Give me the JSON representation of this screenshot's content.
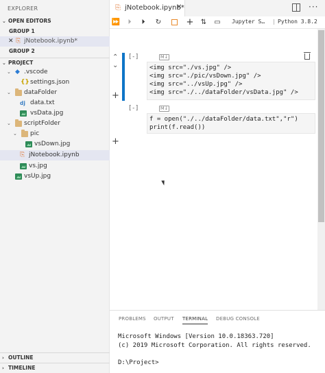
{
  "sidebar": {
    "title": "EXPLORER",
    "open_editors_label": "OPEN EDITORS",
    "group1_label": "GROUP 1",
    "group1_file": "jNotebook.ipynb*",
    "group2_label": "GROUP 2",
    "project_label": "PROJECT",
    "tree": [
      {
        "label": ".vscode",
        "kind": "folder-vscode"
      },
      {
        "label": "settings.json",
        "kind": "json"
      },
      {
        "label": "dataFolder",
        "kind": "folder"
      },
      {
        "label": "data.txt",
        "kind": "dj"
      },
      {
        "label": "vsData.jpg",
        "kind": "image"
      },
      {
        "label": "scriptFolder",
        "kind": "folder"
      },
      {
        "label": "pic",
        "kind": "folder"
      },
      {
        "label": "vsDown.jpg",
        "kind": "image"
      },
      {
        "label": "jNotebook.ipynb",
        "kind": "notebook"
      },
      {
        "label": "vs.jpg",
        "kind": "image"
      },
      {
        "label": "vsUp.jpg",
        "kind": "image"
      }
    ],
    "outline_label": "OUTLINE",
    "timeline_label": "TIMELINE"
  },
  "editor": {
    "tab_label": "jNotebook.ipynb*",
    "kernel_info": "Jupyter S…",
    "kernel_name": "Python 3.8.2",
    "cells": [
      {
        "exec": "[-]",
        "type_badge": "M↓",
        "lines": [
          "<img src=\"./vs.jpg\" />",
          "<img src=\"./pic/vsDown.jpg\" />",
          "<img src=\"../vsUp.jpg\" />",
          "<img src=\"./../dataFolder/vsData.jpg\" />"
        ]
      },
      {
        "exec": "[-]",
        "type_badge": "M↓",
        "lines": [
          "f = open(\"./../dataFolder/data.txt\",\"r\")",
          "print(f.read())"
        ]
      }
    ]
  },
  "panel": {
    "tabs": [
      "PROBLEMS",
      "OUTPUT",
      "TERMINAL",
      "DEBUG CONSOLE"
    ],
    "active_tab": "TERMINAL",
    "terminal_lines": [
      "Microsoft Windows [Version 10.0.18363.720]",
      "(c) 2019 Microsoft Corporation. All rights reserved.",
      "",
      "D:\\Project>"
    ]
  },
  "colors": {
    "accent": "#0e75c7",
    "sidebar_bg": "#f3f3f3",
    "selected_bg": "#e4e6f1",
    "folder": "#dcb67a"
  }
}
